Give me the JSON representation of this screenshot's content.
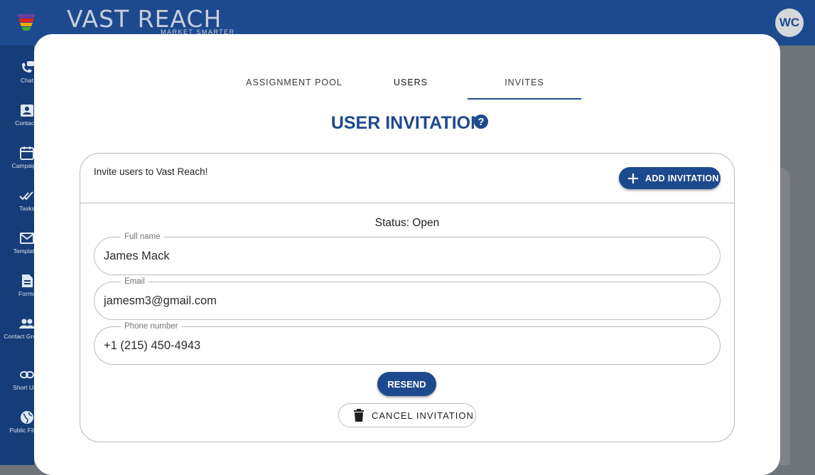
{
  "header": {
    "brand": "VAST REACH",
    "tagline": "MARKET SMARTER",
    "avatar_initials": "WC"
  },
  "sidebar": {
    "items": [
      {
        "label": "Chat",
        "icon": "chat-phone-icon"
      },
      {
        "label": "Contacts",
        "icon": "contacts-icon"
      },
      {
        "label": "Campaigns",
        "icon": "campaign-calendar-icon"
      },
      {
        "label": "Tasks",
        "icon": "double-check-icon"
      },
      {
        "label": "Templates",
        "icon": "envelope-icon"
      },
      {
        "label": "Forms",
        "icon": "form-icon"
      },
      {
        "label": "Contact Groups",
        "icon": "group-icon"
      },
      {
        "label": "Short URL",
        "icon": "link-icon"
      },
      {
        "label": "Public Files",
        "icon": "globe-icon"
      }
    ]
  },
  "modal": {
    "tabs": [
      {
        "label": "ASSIGNMENT POOL"
      },
      {
        "label": "USERS"
      },
      {
        "label": "INVITES"
      }
    ],
    "active_tab": "INVITES",
    "title": "USER INVITATION",
    "card": {
      "intro": "Invite users to Vast Reach!",
      "add_button": "ADD INVITATION",
      "status": "Status: Open",
      "fields": {
        "full_name": {
          "label": "Full name",
          "value": "James Mack"
        },
        "email": {
          "label": "Email",
          "value": "jamesm3@gmail.com"
        },
        "phone": {
          "label": "Phone number",
          "value": "+1 (215) 450-4943"
        }
      },
      "resend_button": "RESEND",
      "cancel_button": "CANCEL INVITATION"
    }
  },
  "colors": {
    "primary": "#1d4a8e",
    "sidebar": "#153d78",
    "overlay": "#6f7479"
  }
}
